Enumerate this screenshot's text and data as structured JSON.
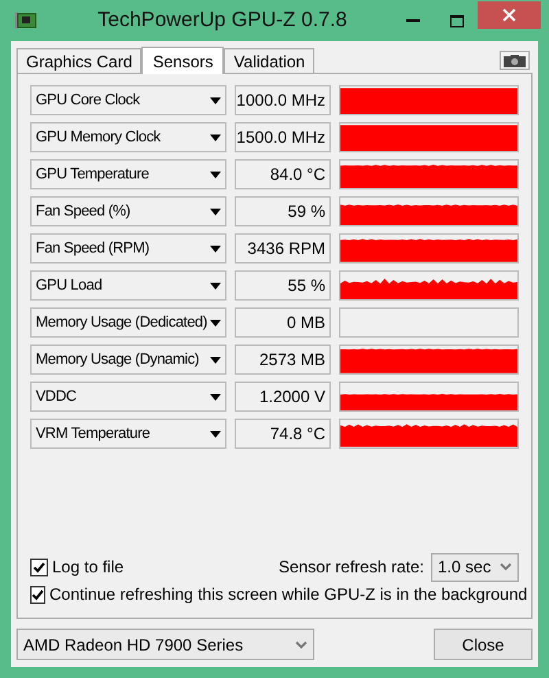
{
  "window": {
    "title": "TechPowerUp GPU-Z 0.7.8"
  },
  "tabs": [
    {
      "label": "Graphics Card",
      "selected": false
    },
    {
      "label": "Sensors",
      "selected": true
    },
    {
      "label": "Validation",
      "selected": false
    }
  ],
  "sensors": [
    {
      "name": "GPU Core Clock",
      "value": "1000.0 MHz",
      "kind": "graph"
    },
    {
      "name": "GPU Memory Clock",
      "value": "1500.0 MHz",
      "kind": "graph"
    },
    {
      "name": "GPU Temperature",
      "value": "84.0 °C",
      "kind": "graph"
    },
    {
      "name": "Fan Speed (%)",
      "value": "59 %",
      "kind": "graph"
    },
    {
      "name": "Fan Speed (RPM)",
      "value": "3436 RPM",
      "kind": "graph"
    },
    {
      "name": "GPU Load",
      "value": "55 %",
      "kind": "graph"
    },
    {
      "name": "Memory Usage (Dedicated)",
      "value": "0 MB",
      "kind": "empty"
    },
    {
      "name": "Memory Usage (Dynamic)",
      "value": "2573 MB",
      "kind": "graph"
    },
    {
      "name": "VDDC",
      "value": "1.2000 V",
      "kind": "graph"
    },
    {
      "name": "VRM Temperature",
      "value": "74.8 °C",
      "kind": "graph"
    }
  ],
  "options": [
    {
      "label": "Log to file",
      "checked": true
    },
    {
      "label": "Continue refreshing this screen while GPU-Z is in the background",
      "checked": true
    }
  ],
  "refresh": {
    "label": "Sensor refresh rate:",
    "value": "1.0 sec"
  },
  "gpu_select": {
    "value": "AMD Radeon HD 7900 Series"
  },
  "close_button": "Close"
}
